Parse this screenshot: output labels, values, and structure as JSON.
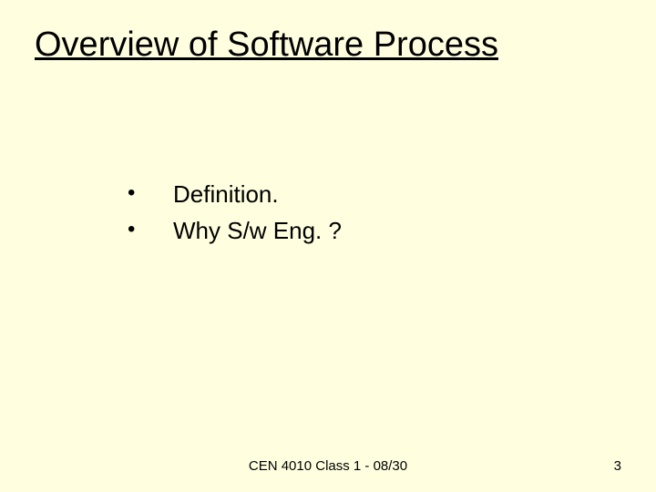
{
  "title": "Overview of Software Process",
  "bullets": [
    "Definition.",
    "Why S/w Eng. ?"
  ],
  "footer": "CEN 4010 Class 1 - 08/30",
  "page_number": "3"
}
